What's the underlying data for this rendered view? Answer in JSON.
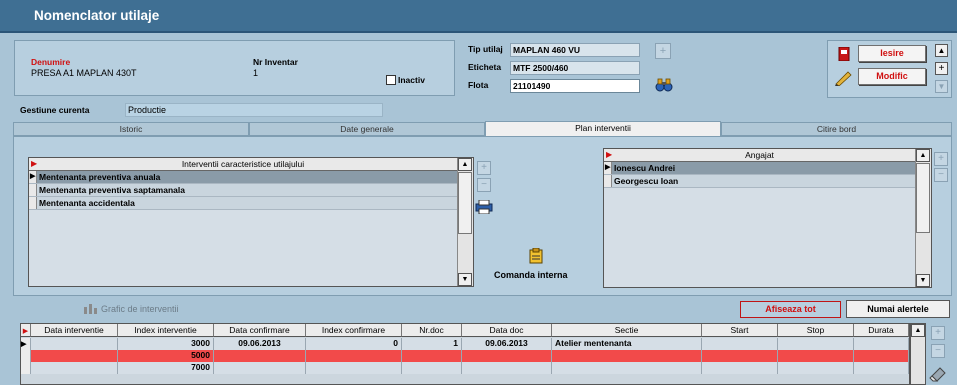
{
  "window": {
    "title": "Nomenclator utilaje"
  },
  "header": {
    "denumire_label": "Denumire",
    "denumire_value": "PRESA A1 MAPLAN 430T",
    "nr_inventar_label": "Nr Inventar",
    "nr_inventar_value": "1",
    "inactiv_label": "Inactiv",
    "tip_utilaj_label": "Tip utilaj",
    "tip_utilaj_value": "MAPLAN 460 VU",
    "eticheta_label": "Eticheta",
    "eticheta_value": "MTF 2500/460",
    "flota_label": "Flota",
    "flota_value": "21101490"
  },
  "actions": {
    "iesire_label": "Iesire",
    "modific_label": "Modific"
  },
  "gestiune": {
    "label": "Gestiune curenta",
    "value": "Productie"
  },
  "tabs": [
    {
      "label": "Istoric",
      "active": false
    },
    {
      "label": "Date generale",
      "active": false
    },
    {
      "label": "Plan interventii",
      "active": true
    },
    {
      "label": "Citire bord",
      "active": false
    }
  ],
  "interventii": {
    "header": "Interventii caracteristice utilajului",
    "rows": [
      "Mentenanta preventiva anuala",
      "Mentenanta preventiva saptamanala",
      "Mentenanta accidentala"
    ]
  },
  "comanda_label": "Comanda interna",
  "angajat": {
    "header": "Angajat",
    "rows": [
      "Ionescu  Andrei",
      "Georgescu Ioan"
    ]
  },
  "grafic_label": "Grafic de interventii",
  "afiseaza_tot_label": "Afiseaza tot",
  "numai_alertele_label": "Numai alertele",
  "table": {
    "columns": [
      "Data interventie",
      "Index interventie",
      "Data confirmare",
      "Index confirmare",
      "Nr.doc",
      "Data doc",
      "Sectie",
      "Start",
      "Stop",
      "Durata"
    ],
    "rows": [
      {
        "data_interventie": "",
        "index_interventie": "3000",
        "data_confirmare": "09.06.2013",
        "index_confirmare": "0",
        "nr_doc": "1",
        "data_doc": "09.06.2013",
        "sectie": "Atelier mentenanta",
        "start": "",
        "stop": "",
        "durata": "",
        "highlight": false
      },
      {
        "data_interventie": "",
        "index_interventie": "5000",
        "data_confirmare": "",
        "index_confirmare": "",
        "nr_doc": "",
        "data_doc": "",
        "sectie": "",
        "start": "",
        "stop": "",
        "durata": "",
        "highlight": true
      },
      {
        "data_interventie": "",
        "index_interventie": "7000",
        "data_confirmare": "",
        "index_confirmare": "",
        "nr_doc": "",
        "data_doc": "",
        "sectie": "",
        "start": "",
        "stop": "",
        "durata": "",
        "highlight": false
      }
    ]
  },
  "colors": {
    "title_bar": "#3f6f93",
    "alert_row": "#f24a4a",
    "accent_red": "#d01010"
  }
}
